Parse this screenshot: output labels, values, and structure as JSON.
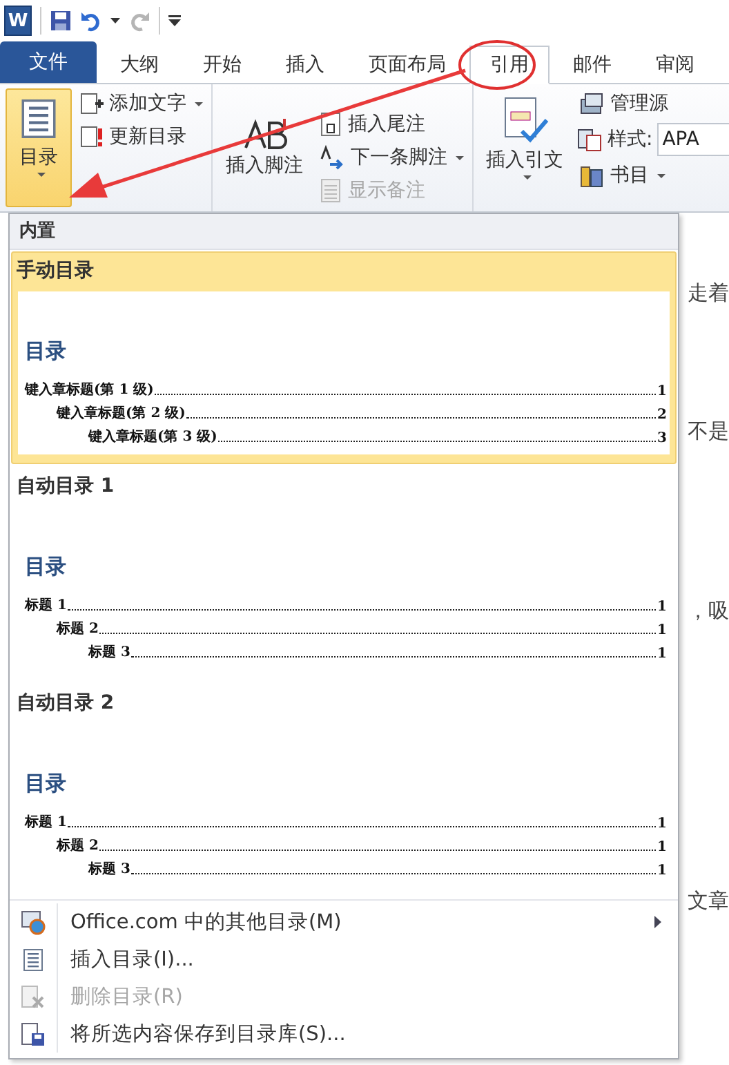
{
  "quick_access": {
    "app_letter": "W",
    "redo_disabled": true
  },
  "tabs": [
    {
      "label": "文件",
      "kind": "file",
      "selected": false
    },
    {
      "label": "大纲",
      "kind": "tab",
      "selected": false
    },
    {
      "label": "开始",
      "kind": "tab",
      "selected": false
    },
    {
      "label": "插入",
      "kind": "tab",
      "selected": false
    },
    {
      "label": "页面布局",
      "kind": "tab",
      "selected": false
    },
    {
      "label": "引用",
      "kind": "tab",
      "selected": true
    },
    {
      "label": "邮件",
      "kind": "tab",
      "selected": false
    },
    {
      "label": "审阅",
      "kind": "tab",
      "selected": false
    }
  ],
  "ribbon": {
    "toc_button": {
      "label": "目录",
      "pressed": true
    },
    "toc_group": [
      {
        "label": "添加文字",
        "dropdown": true,
        "disabled": false
      },
      {
        "label": "更新目录",
        "disabled": false
      }
    ],
    "footnote_button": {
      "label": "插入脚注"
    },
    "footnote_group": [
      {
        "label": "插入尾注",
        "disabled": false
      },
      {
        "label": "下一条脚注",
        "dropdown": true,
        "disabled": false
      },
      {
        "label": "显示备注",
        "disabled": true
      }
    ],
    "citation_button": {
      "label": "插入引文",
      "dropdown": true
    },
    "citation_group": [
      {
        "kind": "button",
        "label": "管理源"
      },
      {
        "kind": "style",
        "label": "样式:",
        "value": "APA"
      },
      {
        "kind": "button",
        "label": "书目",
        "dropdown": true
      }
    ]
  },
  "menu": {
    "header": "内置",
    "entries": [
      {
        "title": "手动目录",
        "selected": true,
        "heading": "目录",
        "lines": [
          {
            "text": "键入章标题(第 1 级)",
            "page": "1",
            "children": [
              {
                "text": "键入章标题(第 2 级)",
                "page": "2",
                "children": [
                  {
                    "text": "键入章标题(第 3 级)",
                    "page": "3"
                  }
                ]
              }
            ]
          }
        ]
      },
      {
        "title": "自动目录 1",
        "selected": false,
        "heading": "目录",
        "lines": [
          {
            "text": "标题 1",
            "page": "1",
            "children": [
              {
                "text": "标题 2",
                "page": "1",
                "children": [
                  {
                    "text": "标题 3",
                    "page": "1"
                  }
                ]
              }
            ]
          }
        ]
      },
      {
        "title": "自动目录 2",
        "selected": false,
        "heading": "目录",
        "lines": [
          {
            "text": "标题 1",
            "page": "1",
            "children": [
              {
                "text": "标题 2",
                "page": "1",
                "children": [
                  {
                    "text": "标题 3",
                    "page": "1"
                  }
                ]
              }
            ]
          }
        ]
      }
    ],
    "commands": [
      {
        "label": "Office.com 中的其他目录(M)",
        "disabled": false,
        "submenu": true
      },
      {
        "label": "插入目录(I)...",
        "disabled": false
      },
      {
        "label": "删除目录(R)",
        "disabled": true
      },
      {
        "label": "将所选内容保存到目录库(S)...",
        "disabled": false
      }
    ]
  },
  "document": {
    "fragments": [
      "走着",
      "不是",
      "，吸",
      "文章"
    ]
  }
}
